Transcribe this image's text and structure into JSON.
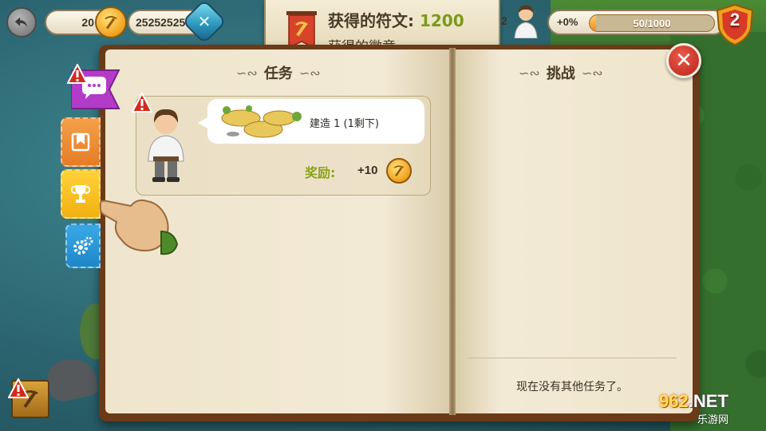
{
  "hud": {
    "coins": "20",
    "gems": "25252525",
    "worker_count": "2",
    "xp_percent": "+0%",
    "xp_text": "50/1000",
    "xp_fraction": 0.05,
    "level": "2"
  },
  "notification": {
    "title": "获得的符文: ",
    "value": "1200",
    "subtitle": "获得的徽章"
  },
  "book": {
    "left_heading": "任务",
    "right_heading": "挑战",
    "quest": {
      "description": "建造 1 (1剩下)",
      "reward_label": "奖励:",
      "reward_value": "+10"
    },
    "empty_message": "现在没有其他任务了。"
  },
  "watermark": {
    "brand_num": "962",
    "brand_net": ".NET",
    "sub": "乐游网"
  },
  "colors": {
    "accent_green": "#8aa31b",
    "close_red": "#c8291d",
    "xp_orange": "#f08b1c"
  },
  "icons": [
    "back-arrow-icon",
    "pickaxe-coin-icon",
    "gem-icon",
    "banner-icon",
    "worker-avatar-icon",
    "level-shield-icon",
    "chat-icon",
    "bookmark-icon",
    "trophy-icon",
    "gear-icon",
    "close-icon",
    "alert-icon",
    "hand-pointer-icon"
  ]
}
